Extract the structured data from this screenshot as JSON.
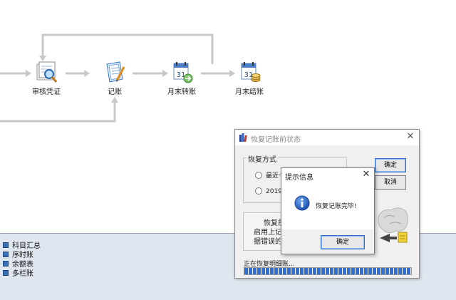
{
  "flow": {
    "nodes": [
      {
        "id": "audit",
        "label": "审核凭证",
        "icon": "audit-voucher-icon"
      },
      {
        "id": "post",
        "label": "记账",
        "icon": "posting-ledger-icon"
      },
      {
        "id": "transfer",
        "label": "月末转账",
        "icon": "month-end-transfer-icon"
      },
      {
        "id": "close",
        "label": "月末结账",
        "icon": "month-end-close-icon"
      }
    ]
  },
  "tree": {
    "items": [
      {
        "label": "科目汇总"
      },
      {
        "label": "序时账"
      },
      {
        "label": "余额表"
      },
      {
        "label": "多栏账"
      }
    ]
  },
  "main_dialog": {
    "title": "恢复记账前状态",
    "group_label": "恢复方式",
    "options": [
      {
        "label": "最近一"
      },
      {
        "label": "2019年"
      }
    ],
    "ok_label": "确定",
    "cancel_label": "取消",
    "desc_lines": [
      "恢复前",
      "启用上记账",
      "据错误的恢"
    ],
    "progress_label": "正在恢复明细账...",
    "progress": 1.0
  },
  "message_dialog": {
    "title": "提示信息",
    "message": "恢复记账完毕!",
    "ok_label": "确定"
  },
  "colors": {
    "accent": "#2f6fd6",
    "panel": "#dfe6ef",
    "connector": "#c8c8c8"
  }
}
